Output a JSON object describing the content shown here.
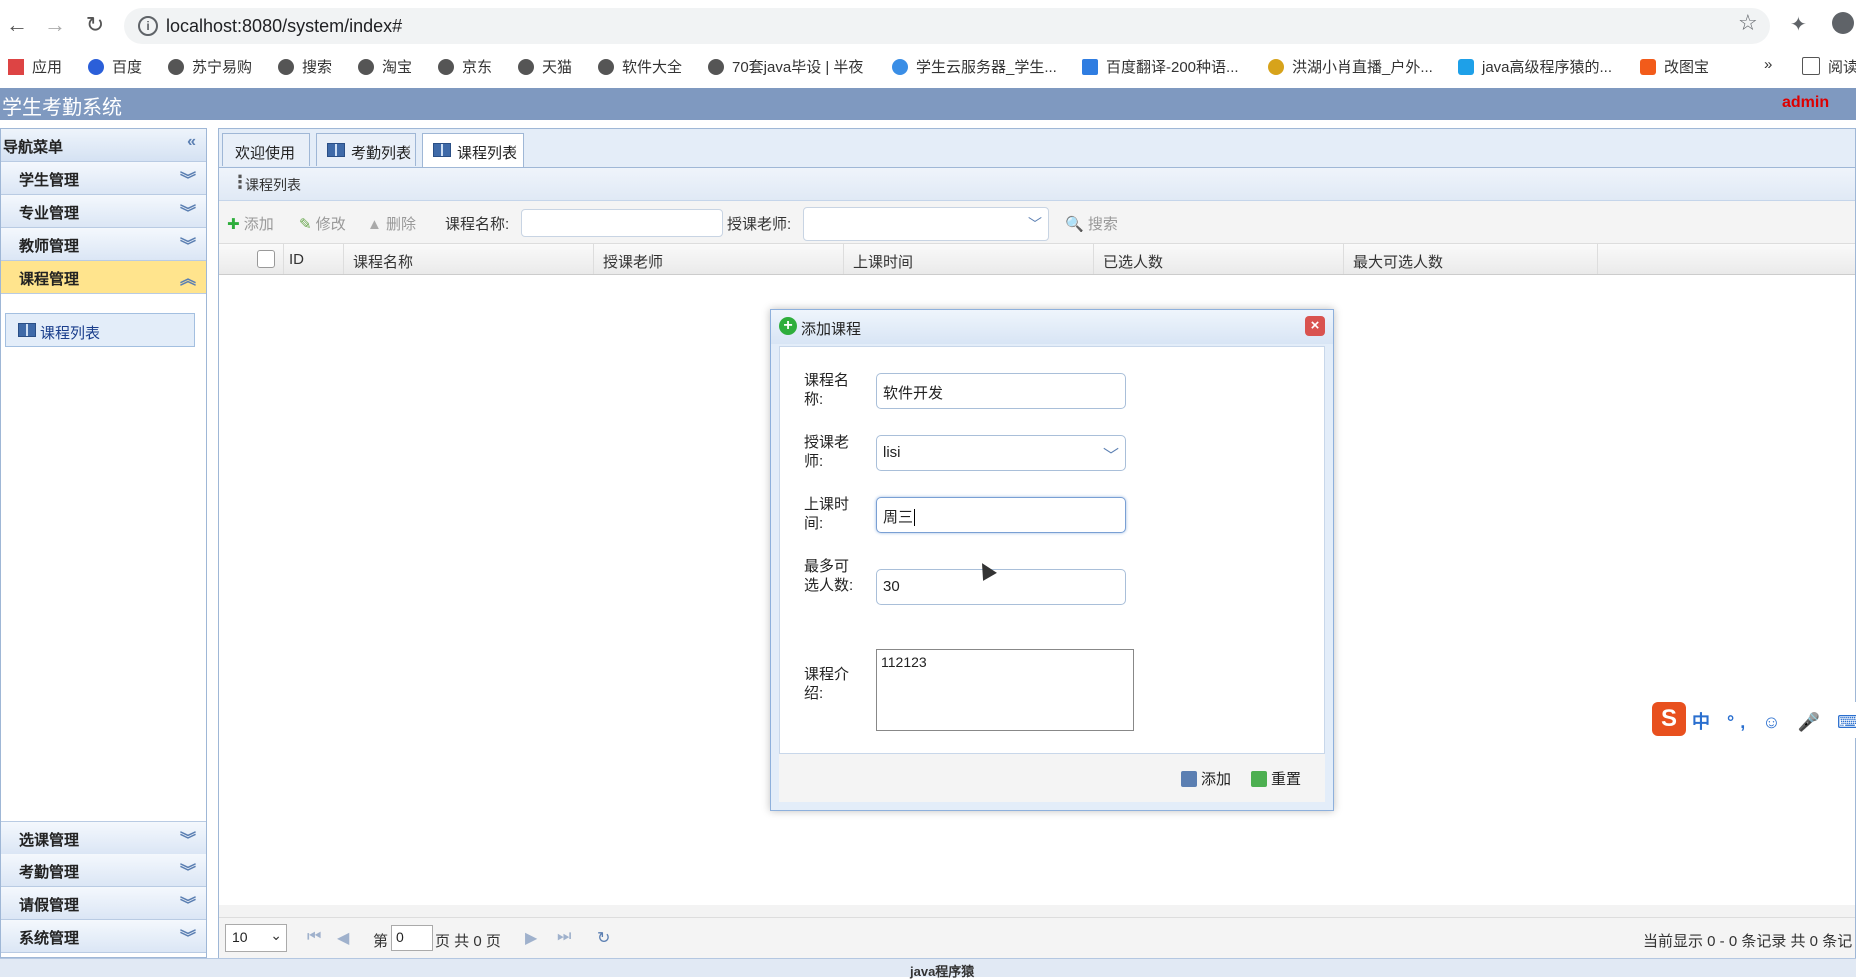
{
  "browser": {
    "url": "localhost:8080/system/index#",
    "bookmarks": [
      "应用",
      "百度",
      "苏宁易购",
      "搜索",
      "淘宝",
      "京东",
      "天猫",
      "软件大全",
      "70套java毕设 | 半夜",
      "学生云服务器_学生...",
      "百度翻译-200种语...",
      "洪湖小肖直播_户外...",
      "java高级程序猿的...",
      "改图宝",
      "»",
      "阅读"
    ]
  },
  "app": {
    "title": "学生考勤系统",
    "user": "admin"
  },
  "sidebar": {
    "title": "导航菜单",
    "collapse_icon": "«",
    "sections_top": [
      "学生管理",
      "专业管理",
      "教师管理",
      "课程管理"
    ],
    "active_item": "课程列表",
    "sections_bottom": [
      "选课管理",
      "考勤管理",
      "请假管理",
      "系统管理"
    ]
  },
  "tabs": [
    "欢迎使用",
    "考勤列表",
    "课程列表"
  ],
  "panel": {
    "title": "课程列表"
  },
  "toolbar": {
    "add": "添加",
    "edit": "修改",
    "delete": "删除",
    "name_label": "课程名称:",
    "teacher_label": "授课老师:",
    "search": "搜索"
  },
  "grid": {
    "columns": [
      "ID",
      "课程名称",
      "授课老师",
      "上课时间",
      "已选人数",
      "最大可选人数"
    ]
  },
  "pager": {
    "page_size": "10",
    "page_prefix": "第",
    "page_value": "0",
    "page_suffix": "页 共 0 页",
    "summary": "当前显示 0 - 0 条记录 共 0 条记"
  },
  "footer": {
    "text": "java程序猿"
  },
  "modal": {
    "title": "添加课程",
    "fields": {
      "name_label": "课程名称:",
      "name_value": "软件开发",
      "teacher_label": "授课老师:",
      "teacher_value": "lisi",
      "time_label": "上课时间:",
      "time_value": "周三",
      "max_label": "最多可选人数:",
      "max_value": "30",
      "intro_label": "课程介绍:",
      "intro_value": "112123"
    },
    "add_button": "添加",
    "reset_button": "重置"
  },
  "ime": {
    "logo": "S",
    "items": "中 °, ☺ 🎤 ⌨ 👤"
  }
}
